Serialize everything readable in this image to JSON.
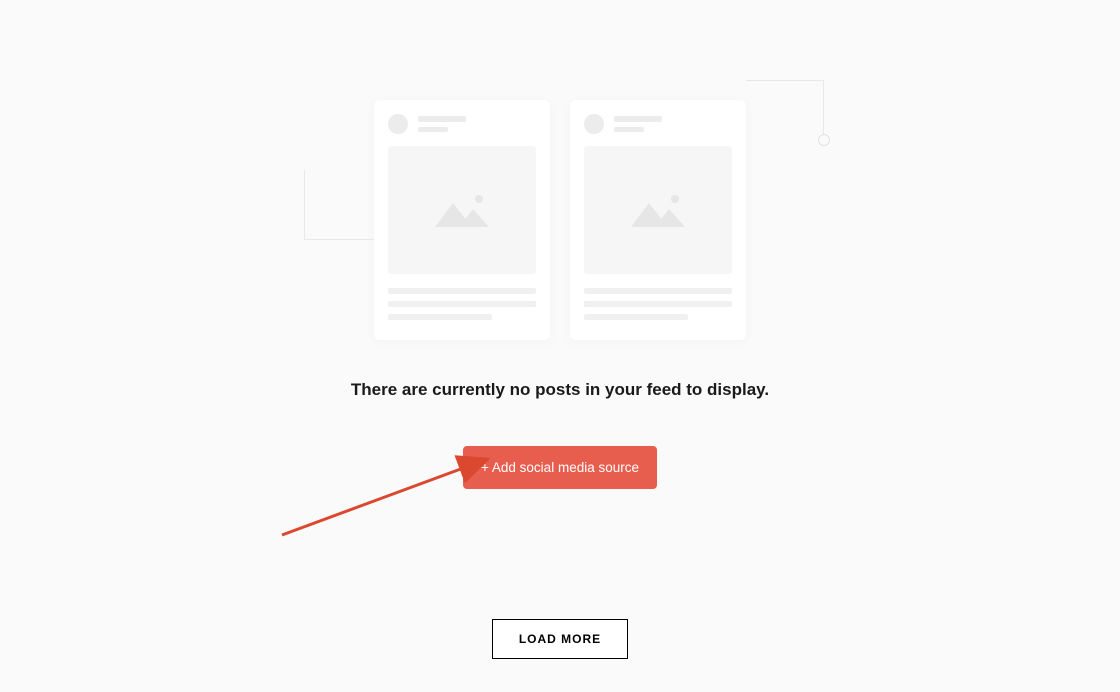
{
  "empty_state": {
    "message": "There are currently no posts in your feed to display.",
    "add_button_label": "+ Add social media source"
  },
  "footer": {
    "load_more_label": "LOAD MORE"
  },
  "colors": {
    "primary_button": "#e85e4e",
    "background": "#fafafa"
  }
}
